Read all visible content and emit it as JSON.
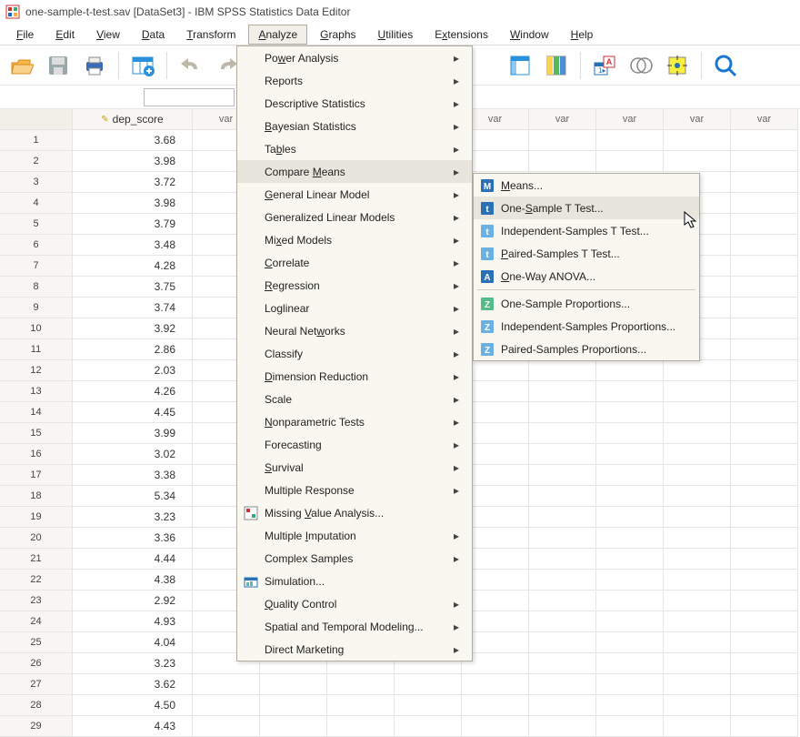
{
  "title": "one-sample-t-test.sav [DataSet3] - IBM SPSS Statistics Data Editor",
  "menubar": [
    "File",
    "Edit",
    "View",
    "Data",
    "Transform",
    "Analyze",
    "Graphs",
    "Utilities",
    "Extensions",
    "Window",
    "Help"
  ],
  "menubar_u": [
    "F",
    "E",
    "V",
    "D",
    "T",
    "A",
    "G",
    "U",
    "x",
    "W",
    "H"
  ],
  "active_menu_index": 5,
  "search_value": "",
  "column_header_var": "dep_score",
  "var_label": "var",
  "data_values": [
    "3.68",
    "3.98",
    "3.72",
    "3.98",
    "3.79",
    "3.48",
    "4.28",
    "3.75",
    "3.74",
    "3.92",
    "2.86",
    "2.03",
    "4.26",
    "4.45",
    "3.99",
    "3.02",
    "3.38",
    "5.34",
    "3.23",
    "3.36",
    "4.44",
    "4.38",
    "2.92",
    "4.93",
    "4.04",
    "3.23",
    "3.62",
    "4.50",
    "4.43"
  ],
  "analyze_menu": [
    {
      "label": "Power Analysis",
      "arrow": true,
      "u": "w",
      "icon": null
    },
    {
      "label": "Reports",
      "arrow": true,
      "u": "P",
      "icon": null
    },
    {
      "label": "Descriptive Statistics",
      "arrow": true,
      "u": "E",
      "icon": null
    },
    {
      "label": "Bayesian Statistics",
      "arrow": true,
      "u": "B",
      "icon": null
    },
    {
      "label": "Tables",
      "arrow": true,
      "u": "b",
      "icon": null
    },
    {
      "label": "Compare Means",
      "arrow": true,
      "u": "M",
      "icon": null,
      "hover": true
    },
    {
      "label": "General Linear Model",
      "arrow": true,
      "u": "G",
      "icon": null
    },
    {
      "label": "Generalized Linear Models",
      "arrow": true,
      "u": "Z",
      "icon": null
    },
    {
      "label": "Mixed Models",
      "arrow": true,
      "u": "x",
      "icon": null
    },
    {
      "label": "Correlate",
      "arrow": true,
      "u": "C",
      "icon": null
    },
    {
      "label": "Regression",
      "arrow": true,
      "u": "R",
      "icon": null
    },
    {
      "label": "Loglinear",
      "arrow": true,
      "u": "O",
      "icon": null
    },
    {
      "label": "Neural Networks",
      "arrow": false,
      "u": "w",
      "icon": null,
      "arrow2": true
    },
    {
      "label": "Classify",
      "arrow": true,
      "u": "F",
      "icon": null
    },
    {
      "label": "Dimension Reduction",
      "arrow": true,
      "u": "D",
      "icon": null
    },
    {
      "label": "Scale",
      "arrow": true,
      "u": "A",
      "icon": null
    },
    {
      "label": "Nonparametric Tests",
      "arrow": true,
      "u": "N",
      "icon": null
    },
    {
      "label": "Forecasting",
      "arrow": true,
      "u": "T",
      "icon": null
    },
    {
      "label": "Survival",
      "arrow": true,
      "u": "S",
      "icon": null
    },
    {
      "label": "Multiple Response",
      "arrow": true,
      "u": "U",
      "icon": null
    },
    {
      "label": "Missing Value Analysis...",
      "arrow": false,
      "u": "V",
      "icon": "missing"
    },
    {
      "label": "Multiple Imputation",
      "arrow": true,
      "u": "I",
      "icon": null
    },
    {
      "label": "Complex Samples",
      "arrow": true,
      "u": "L",
      "icon": null
    },
    {
      "label": "Simulation...",
      "arrow": false,
      "u": "",
      "icon": "sim"
    },
    {
      "label": "Quality Control",
      "arrow": true,
      "u": "Q",
      "icon": null
    },
    {
      "label": "Spatial and Temporal Modeling...",
      "arrow": true,
      "u": "",
      "icon": null
    },
    {
      "label": "Direct Marketing",
      "arrow": true,
      "u": "K",
      "icon": null
    }
  ],
  "compare_means_menu": [
    {
      "label": "Means...",
      "u": "M",
      "icon": "M",
      "sep": false
    },
    {
      "label": "One-Sample T Test...",
      "u": "S",
      "icon": "t",
      "sep": false,
      "hover": true
    },
    {
      "label": "Independent-Samples T Test...",
      "u": "",
      "icon": "t2",
      "sep": false
    },
    {
      "label": "Paired-Samples T Test...",
      "u": "P",
      "icon": "t2",
      "sep": false
    },
    {
      "label": "One-Way ANOVA...",
      "u": "O",
      "icon": "A",
      "sep": true
    },
    {
      "label": "One-Sample Proportions...",
      "u": "",
      "icon": "Z",
      "sep": false
    },
    {
      "label": "Independent-Samples Proportions...",
      "u": "",
      "icon": "Z2",
      "sep": false
    },
    {
      "label": "Paired-Samples Proportions...",
      "u": "",
      "icon": "Z2",
      "sep": false
    }
  ]
}
